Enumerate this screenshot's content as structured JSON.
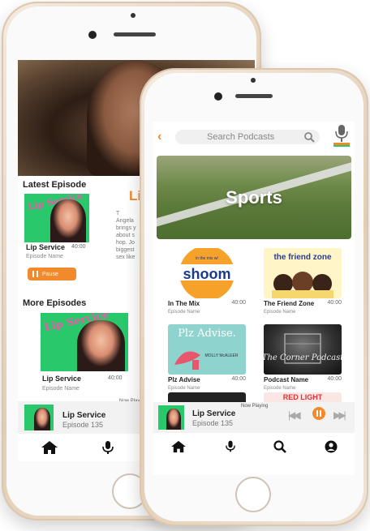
{
  "back_phone": {
    "latest_episode_heading": "Latest Episode",
    "latest_episode": {
      "art_title": "Lip Service",
      "name": "Lip Service",
      "duration": "40:00",
      "subtitle": "Episode Name"
    },
    "pause_label": "Pause",
    "promo": {
      "title": "Li",
      "text": "T\nAngela\nbrings y\nabout s\nhop. Jo\nbiggest\nsex like"
    },
    "more_episodes_heading": "More Episodes",
    "more_episode": {
      "art_title": "Lip Service",
      "name": "Lip Service",
      "duration": "40:00",
      "subtitle": "Episode Name"
    },
    "now_playing_label": "Now Playi",
    "mini_player": {
      "title": "Lip Service",
      "subtitle": "Episode 135"
    }
  },
  "front_phone": {
    "search": {
      "placeholder": "Search Podcasts"
    },
    "banner_label": "Sports",
    "cards": [
      {
        "name": "In The Mix",
        "duration": "40:00",
        "subtitle": "Episode Name",
        "art_top": "in the mix w/",
        "art_main": "shoom"
      },
      {
        "name": "The Friend Zone",
        "duration": "40:00",
        "subtitle": "Episode Name",
        "art_main": "the friend zone"
      },
      {
        "name": "Plz Advise",
        "duration": "40:00",
        "subtitle": "Episode Name",
        "art_main": "Plz Advise.",
        "art_credit": "MOLLY McALEER"
      },
      {
        "name": "Podcast Name",
        "duration": "40:00",
        "subtitle": "Episode Name",
        "art_main": "The Corner Podcast"
      }
    ],
    "peek_card_text": "RED LIGHT",
    "now_playing_label": "Now Playing",
    "player": {
      "title": "Lip Service",
      "subtitle": "Episode 135"
    }
  },
  "colors": {
    "accent": "#f18a2c",
    "green_art": "#29c96b",
    "pink_text": "#e85aa8"
  }
}
